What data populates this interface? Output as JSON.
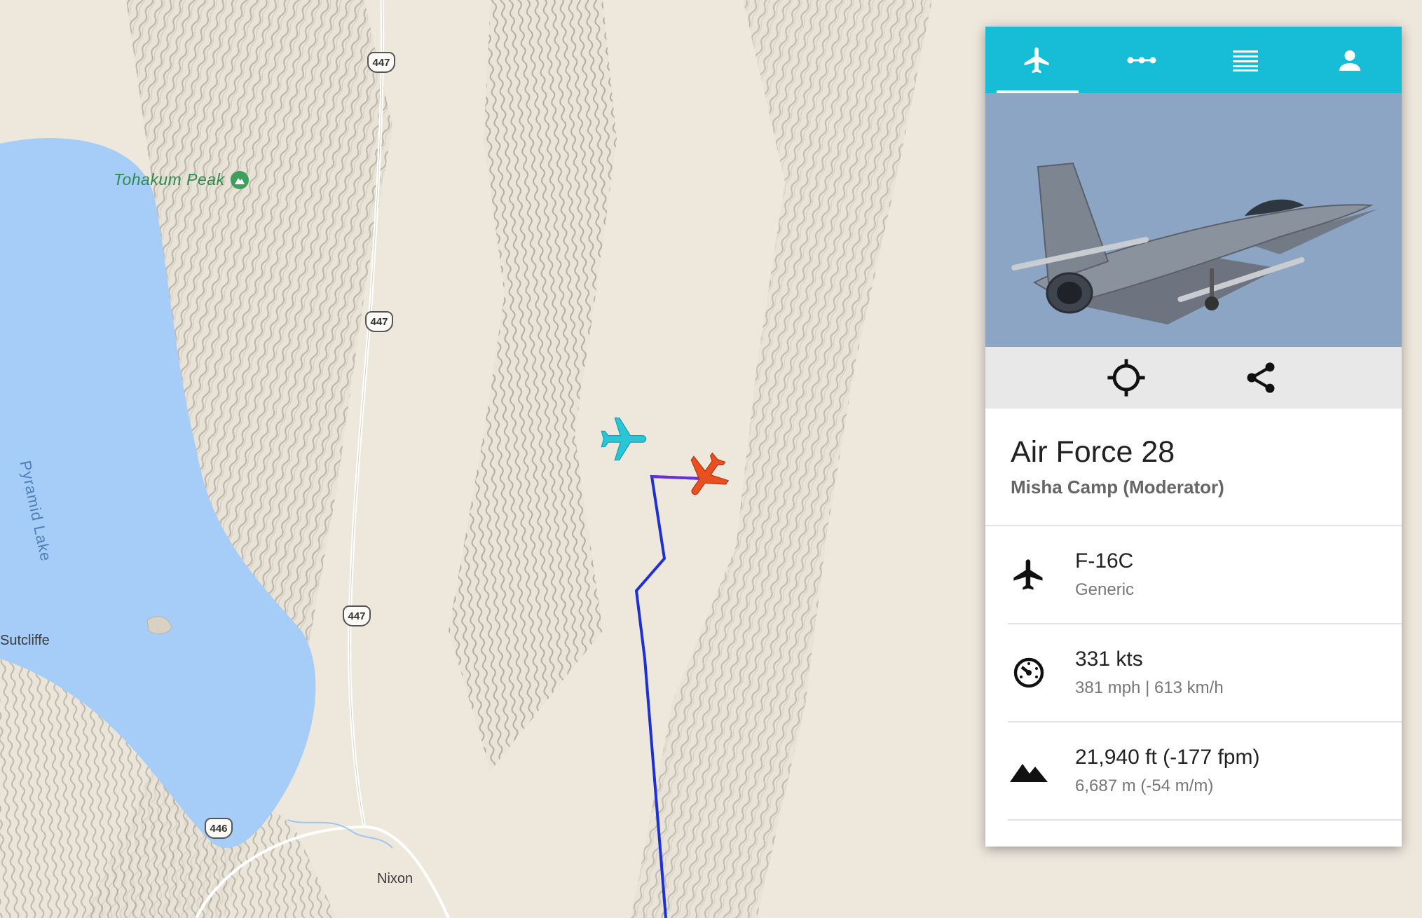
{
  "map": {
    "labels": {
      "peak": "Tohakum Peak",
      "lake": "Pyramid Lake",
      "town_sutcliffe": "Sutcliffe",
      "town_nixon": "Nixon"
    },
    "road_shields": [
      "447",
      "447",
      "447",
      "446"
    ],
    "markers": {
      "other_aircraft": "airplane-icon",
      "selected_aircraft": "airplane-icon"
    },
    "colors": {
      "lake": "#a5cdf7",
      "land": "#ede6da",
      "flight_path": "#1d2fd6",
      "other_aircraft": "#2bc6d6",
      "selected_aircraft": "#e8501f"
    }
  },
  "panel": {
    "tabs": [
      {
        "name": "tab-aircraft",
        "icon": "airplane-icon",
        "active": true
      },
      {
        "name": "tab-route",
        "icon": "route-dots-icon",
        "active": false
      },
      {
        "name": "tab-list",
        "icon": "list-icon",
        "active": false
      },
      {
        "name": "tab-profile",
        "icon": "person-icon",
        "active": false
      }
    ],
    "actions": [
      {
        "name": "locate-button",
        "icon": "crosshair-icon"
      },
      {
        "name": "share-button",
        "icon": "share-icon"
      }
    ],
    "callsign": "Air Force 28",
    "pilot": "Misha Camp (Moderator)",
    "aircraft": {
      "model": "F-16C",
      "livery": "Generic",
      "icon": "airplane-icon"
    },
    "speed": {
      "primary": "331 kts",
      "secondary": "381 mph | 613 km/h",
      "icon": "speedometer-icon"
    },
    "altitude": {
      "primary": "21,940 ft (-177 fpm)",
      "secondary": "6,687 m (-54 m/m)",
      "icon": "mountain-icon"
    },
    "accent_color": "#17bcd6"
  }
}
